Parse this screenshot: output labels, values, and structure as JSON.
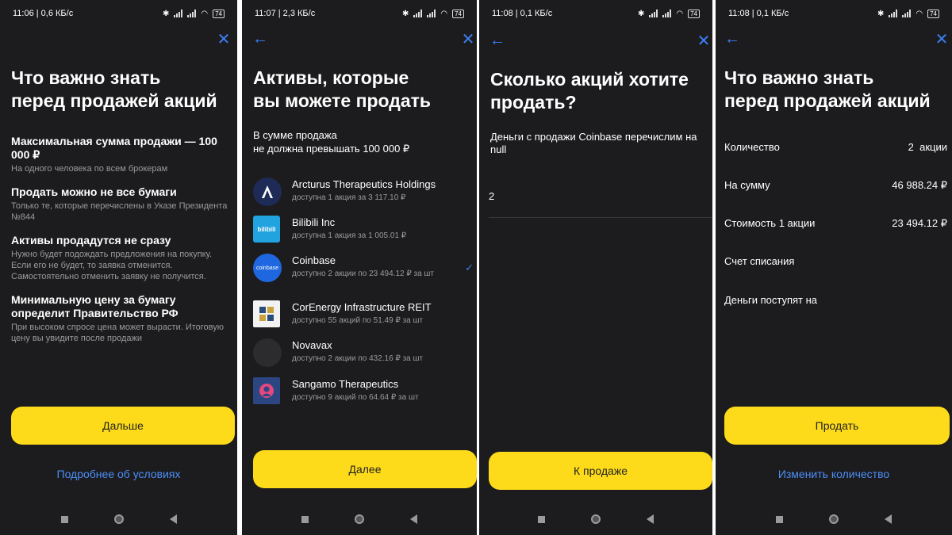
{
  "screen1": {
    "status_time": "11:06 | 0,6 КБ/с",
    "battery": "74",
    "title_line1": "Что важно знать",
    "title_line2": "перед продажей акций",
    "blocks": [
      {
        "heading": "Максимальная сумма продажи — 100 000 ₽",
        "sub": "На одного человека по всем брокерам"
      },
      {
        "heading": "Продать можно не все бумаги",
        "sub": "Только те, которые перечислены в Указе Президента №844"
      },
      {
        "heading": "Активы продадутся не сразу",
        "sub": "Нужно будет подождать предложения на покупку. Если его не будет, то заявка отменится. Самостоятельно отменить заявку не получится."
      },
      {
        "heading": "Минимальную цену за бумагу определит Правительство РФ",
        "sub": "При высоком спросе цена может вырасти. Итоговую цену вы увидите после продажи"
      }
    ],
    "button_label": "Дальше",
    "link_label": "Подробнее об условиях"
  },
  "screen2": {
    "status_time": "11:07 | 2,3 КБ/с",
    "battery": "74",
    "title_line1": "Активы, которые",
    "title_line2": "вы можете продать",
    "subtitle_line1": "В сумме продажа",
    "subtitle_line2": "не должна превышать 100 000 ₽",
    "assets": [
      {
        "name": "Arcturus Therapeutics Holdings",
        "sub": "доступна 1 акция за 3 117.10 ₽"
      },
      {
        "name": "Bilibili Inc",
        "sub": "доступна 1 акция за 1 005.01 ₽",
        "logo_text": "bilibili"
      },
      {
        "name": "Coinbase",
        "sub": "доступно 2 акции по 23 494.12 ₽ за шт",
        "logo_text": "coinbase"
      },
      {
        "name": "CorEnergy Infrastructure REIT",
        "sub": "доступно 55 акций по 51.49 ₽ за шт"
      },
      {
        "name": "Novavax",
        "sub": "доступно 2 акции по 432.16 ₽ за шт"
      },
      {
        "name": "Sangamo Therapeutics",
        "sub": "доступно 9 акций по 64.64 ₽ за шт"
      }
    ],
    "button_label": "Далее"
  },
  "screen3": {
    "status_time": "11:08 | 0,1 КБ/с",
    "battery": "74",
    "title_line1": "Сколько акций хотите",
    "title_line2": "продать?",
    "info_line1": "Деньги с продажи Coinbase перечислим на",
    "info_line2": "null",
    "quantity_value": "2",
    "button_label": "К продаже"
  },
  "screen4": {
    "status_time": "11:08 | 0,1 КБ/с",
    "battery": "74",
    "title_line1": "Что важно знать",
    "title_line2": "перед продажей акций",
    "rows": [
      {
        "label": "Количество",
        "value": "2  акции"
      },
      {
        "label": "На сумму",
        "value": "46 988.24 ₽"
      },
      {
        "label": "Стоимость 1 акции",
        "value": "23 494.12 ₽"
      },
      {
        "label": "Счет списания",
        "value": ""
      },
      {
        "label": "Деньги поступят на",
        "value": ""
      }
    ],
    "button_label": "Продать",
    "link_label": "Изменить количество"
  },
  "colors": {
    "background": "#1c1c1e",
    "accent_yellow": "#fddb1a",
    "link_blue": "#4b8ef7",
    "secondary_text": "#9a9a9e"
  }
}
